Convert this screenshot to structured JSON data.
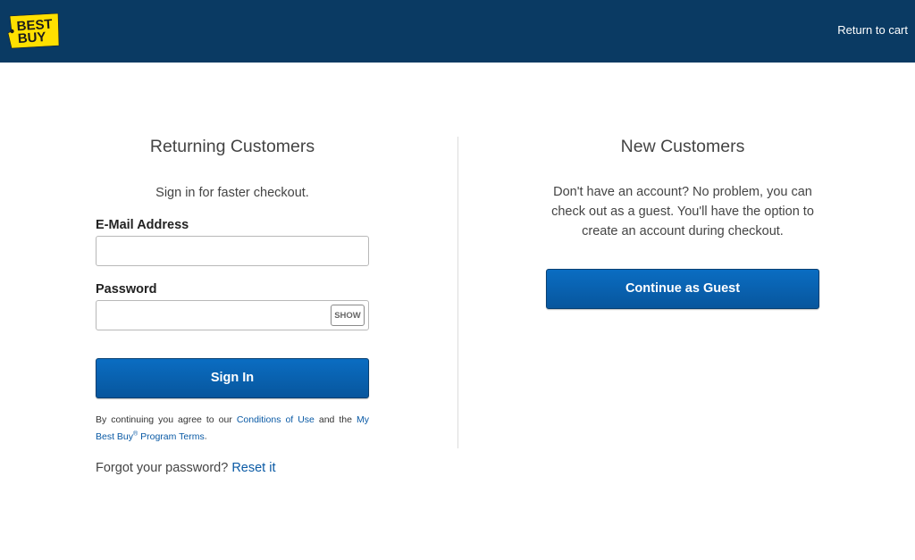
{
  "header": {
    "logo_text_line1": "BEST",
    "logo_text_line2": "BUY",
    "return_link": "Return to cart",
    "bg_color": "#0a3a63",
    "logo_color": "#ffe000"
  },
  "returning": {
    "title": "Returning Customers",
    "subtitle": "Sign in for faster checkout.",
    "email_label": "E-Mail Address",
    "email_value": "",
    "password_label": "Password",
    "password_value": "",
    "show_label": "SHOW",
    "sign_in_label": "Sign In",
    "terms_prefix": "By continuing you agree to our ",
    "terms_link1": "Conditions of Use",
    "terms_mid": " and the ",
    "terms_link2_a": "My Best Buy",
    "terms_link2_sup": "®",
    "terms_link2_b": " Program Terms",
    "terms_suffix": ".",
    "forgot_text": "Forgot your password?",
    "reset_link": "Reset it"
  },
  "new_customers": {
    "title": "New Customers",
    "description": "Don't have an account? No problem, you can check out as a guest. You'll have the option to create an account during checkout.",
    "guest_button": "Continue as Guest"
  },
  "colors": {
    "primary_button": "#0a62b3",
    "link": "#0a5aa5"
  }
}
